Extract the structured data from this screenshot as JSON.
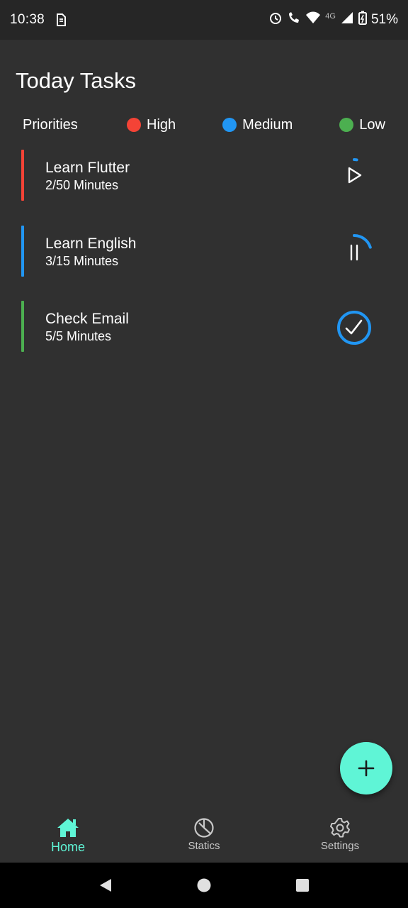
{
  "status_bar": {
    "time": "10:38",
    "network": "4G",
    "battery": "51%"
  },
  "title": "Today Tasks",
  "priorities": {
    "label": "Priorities",
    "items": [
      {
        "label": "High",
        "color": "#f44336"
      },
      {
        "label": "Medium",
        "color": "#2196f3"
      },
      {
        "label": "Low",
        "color": "#4caf50"
      }
    ]
  },
  "tasks": [
    {
      "name": "Learn Flutter",
      "minutes": "2/50 Minutes",
      "priority_color": "#f44336",
      "state": "play",
      "progress": 0.04
    },
    {
      "name": "Learn English",
      "minutes": "3/15 Minutes",
      "priority_color": "#2196f3",
      "state": "pause",
      "progress": 0.2
    },
    {
      "name": "Check Email",
      "minutes": "5/5 Minutes",
      "priority_color": "#4caf50",
      "state": "done",
      "progress": 1.0
    }
  ],
  "bottom_nav": {
    "items": [
      {
        "label": "Home",
        "icon": "home-icon",
        "active": true
      },
      {
        "label": "Statics",
        "icon": "pie-chart-icon",
        "active": false
      },
      {
        "label": "Settings",
        "icon": "gear-icon",
        "active": false
      }
    ]
  },
  "accent_color": "#5ff5d6"
}
